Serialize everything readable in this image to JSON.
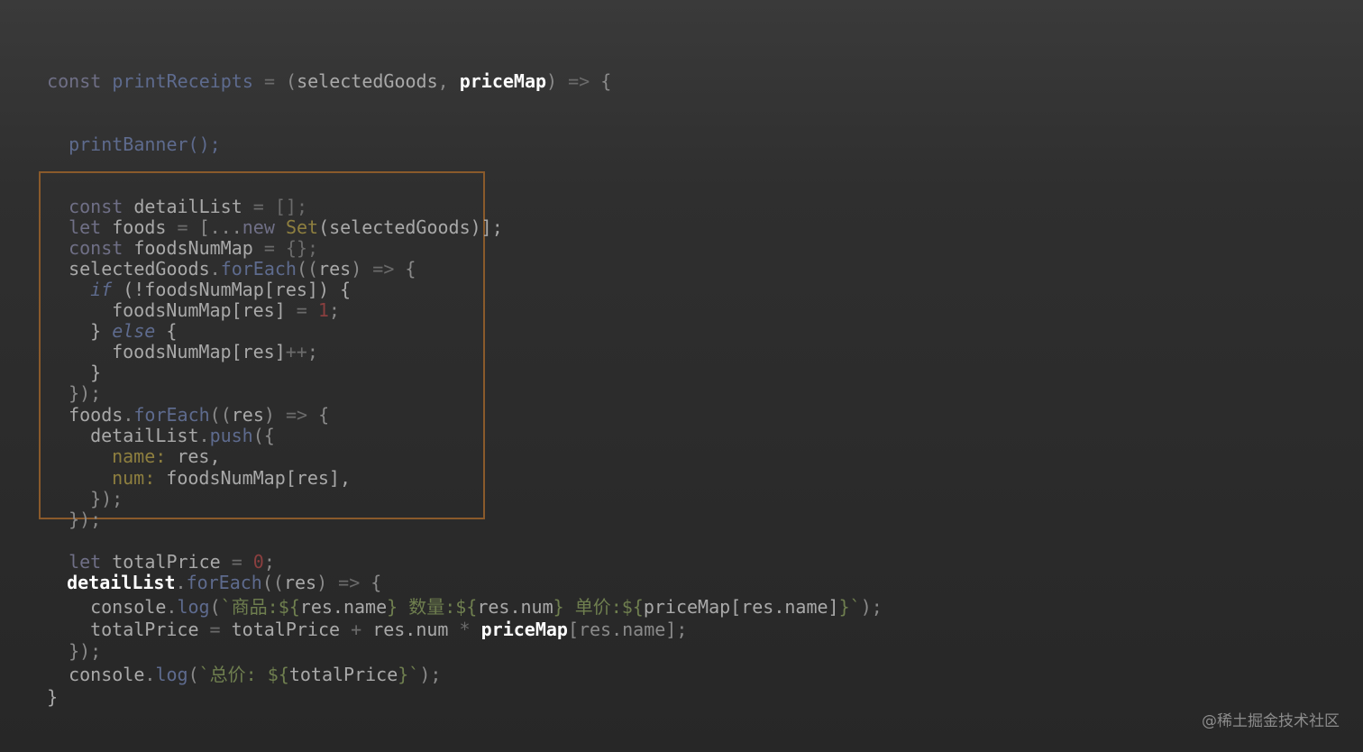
{
  "code": {
    "line_01": {
      "const": "const",
      "name": "printReceipts",
      "eq": " = ",
      "open": "(",
      "p1": "selectedGoods",
      "comma": ", ",
      "p2": "priceMap",
      "close": ")",
      "arrow": " => ",
      "brace": "{"
    },
    "line_02": {
      "call": "printBanner",
      "rest": "();"
    },
    "line_03": {
      "kw": "const",
      "name": " detailList",
      "rest": " = [];"
    },
    "line_04": {
      "kw": "let",
      "name": " foods",
      "eq": " = ",
      "open": "[...",
      "newkw": "new",
      "sp": " ",
      "cls": "Set",
      "rest": "(selectedGoods)];"
    },
    "line_05": {
      "kw": "const",
      "name": " foodsNumMap",
      "rest": " = {};"
    },
    "line_06": {
      "obj": "selectedGoods",
      "dot": ".",
      "method": "forEach",
      "open": "((",
      "arg": "res",
      "close": ")",
      "arrow": " => ",
      "brace": "{"
    },
    "line_07": {
      "kw": "if",
      "rest": " (!foodsNumMap[res]) {"
    },
    "line_08": {
      "lhs": "foodsNumMap[res]",
      "eq": " = ",
      "num": "1",
      "semi": ";"
    },
    "line_09": {
      "open": "} ",
      "kw": "else",
      "brace": " {"
    },
    "line_10": {
      "lhs": "foodsNumMap[res]",
      "op": "++",
      "semi": ";"
    },
    "line_11": {
      "brace": "}"
    },
    "line_12": {
      "close": "});"
    },
    "line_13": {
      "obj": "foods",
      "dot": ".",
      "method": "forEach",
      "open": "((",
      "arg": "res",
      "close": ")",
      "arrow": " => ",
      "brace": "{"
    },
    "line_14": {
      "obj": "detailList",
      "dot": ".",
      "method": "push",
      "open": "({"
    },
    "line_15": {
      "key": "name:",
      "val": " res,"
    },
    "line_16": {
      "key": "num:",
      "val": " foodsNumMap[res],"
    },
    "line_17": {
      "close": "});"
    },
    "line_18": {
      "close": "});"
    },
    "line_19": {
      "kw": "let",
      "name": " totalPrice",
      "eq": " = ",
      "num": "0",
      "semi": ";"
    },
    "line_20": {
      "obj": "detailList",
      "dot": ".",
      "method": "forEach",
      "open": "((",
      "arg": "res",
      "close": ")",
      "arrow": " => ",
      "brace": "{"
    },
    "line_21": {
      "obj": "console",
      "dot": ".",
      "method": "log",
      "open": "(",
      "s1": "`商品:${",
      "e1": "res.name",
      "s2": "} 数量:${",
      "e2": "res.num",
      "s3": "} 单价:${",
      "e3": "priceMap[res.name]",
      "s4": "}`",
      "close": ");"
    },
    "line_22": {
      "lhs": "totalPrice",
      "eq": " = ",
      "a": "totalPrice",
      "plus": " + ",
      "b": "res.num",
      "mul": " * ",
      "hl": "priceMap",
      "rest": "[res.name];"
    },
    "line_23": {
      "close": "});"
    },
    "line_24": {
      "obj": "console",
      "dot": ".",
      "method": "log",
      "open": "(",
      "s1": "`总价: ${",
      "e1": "totalPrice",
      "s2": "}`",
      "close": ");"
    },
    "line_25": {
      "brace": "}"
    }
  },
  "watermark": "@稀土掘金技术社区"
}
